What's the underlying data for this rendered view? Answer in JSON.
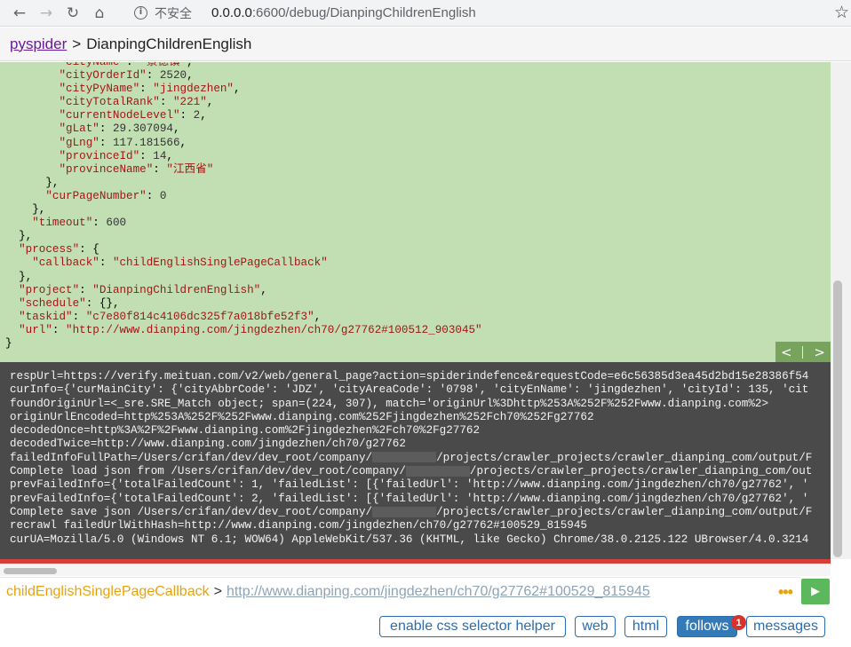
{
  "browser": {
    "back_icon": "back-arrow-icon",
    "forward_icon": "forward-arrow-icon",
    "insecure_label": "不安全",
    "url_host": "0.0.0.0",
    "url_rest": ":6600/debug/DianpingChildrenEnglish"
  },
  "header": {
    "brand": "pyspider",
    "separator": ">",
    "project": "DianpingChildrenEnglish"
  },
  "task_json": {
    "lines": [
      [
        "        ",
        "\"cityName\"",
        ": ",
        "\"景德镇\"",
        ","
      ],
      [
        "        ",
        "\"cityOrderId\"",
        ": ",
        "2520",
        ","
      ],
      [
        "        ",
        "\"cityPyName\"",
        ": ",
        "\"jingdezhen\"",
        ","
      ],
      [
        "        ",
        "\"cityTotalRank\"",
        ": ",
        "\"221\"",
        ","
      ],
      [
        "        ",
        "\"currentNodeLevel\"",
        ": ",
        "2",
        ","
      ],
      [
        "        ",
        "\"gLat\"",
        ": ",
        "29.307094",
        ","
      ],
      [
        "        ",
        "\"gLng\"",
        ": ",
        "117.181566",
        ","
      ],
      [
        "        ",
        "\"provinceId\"",
        ": ",
        "14",
        ","
      ],
      [
        "        ",
        "\"provinceName\"",
        ": ",
        "\"江西省\"",
        ""
      ],
      [
        "      ",
        "",
        "",
        "},",
        ""
      ],
      [
        "      ",
        "\"curPageNumber\"",
        ": ",
        "0",
        ""
      ],
      [
        "    ",
        "",
        "",
        "},",
        ""
      ],
      [
        "    ",
        "\"timeout\"",
        ": ",
        "600",
        ""
      ],
      [
        "  ",
        "",
        "",
        "},",
        ""
      ],
      [
        "  ",
        "\"process\"",
        ": ",
        "{",
        ""
      ],
      [
        "    ",
        "\"callback\"",
        ": ",
        "\"childEnglishSinglePageCallback\"",
        ""
      ],
      [
        "  ",
        "",
        "",
        "},",
        ""
      ],
      [
        "  ",
        "\"project\"",
        ": ",
        "\"DianpingChildrenEnglish\"",
        ","
      ],
      [
        "  ",
        "\"schedule\"",
        ": ",
        "{}",
        ","
      ],
      [
        "  ",
        "\"taskid\"",
        ": ",
        "\"c7e80f814c4106dc325f7a018bfe52f3\"",
        ","
      ],
      [
        "  ",
        "\"url\"",
        ": ",
        "\"http://www.dianping.com/jingdezhen/ch70/g27762#100512_903045\"",
        ""
      ],
      [
        "",
        "",
        "",
        "}",
        ""
      ]
    ],
    "pager_prev": "<",
    "pager_next": ">"
  },
  "log": {
    "lines": [
      "respUrl=https://verify.meituan.com/v2/web/general_page?action=spiderindefence&requestCode=e6c56385d3ea45d2bd15e28386f54",
      "curInfo={'curMainCity': {'cityAbbrCode': 'JDZ', 'cityAreaCode': '0798', 'cityEnName': 'jingdezhen', 'cityId': 135, 'cit",
      "foundOriginUrl=<_sre.SRE_Match object; span=(224, 307), match='originUrl%3Dhttp%253A%252F%252Fwww.dianping.com%2>",
      "originUrlEncoded=http%253A%252F%252Fwww.dianping.com%252Fjingdezhen%252Fch70%252Fg27762",
      "decodedOnce=http%3A%2F%2Fwww.dianping.com%2Fjingdezhen%2Fch70%2Fg27762",
      "decodedTwice=http://www.dianping.com/jingdezhen/ch70/g27762",
      "failedInfoFullPath=/Users/crifan/dev/dev_root/company/",
      "Complete load json from /Users/crifan/dev/dev_root/company/",
      "prevFailedInfo={'totalFailedCount': 1, 'failedList': [{'failedUrl': 'http://www.dianping.com/jingdezhen/ch70/g27762', '",
      "prevFailedInfo={'totalFailedCount': 2, 'failedList': [{'failedUrl': 'http://www.dianping.com/jingdezhen/ch70/g27762', '",
      "Complete save json /Users/crifan/dev/dev_root/company/",
      "recrawl failedUrlWithHash=http://www.dianping.com/jingdezhen/ch70/g27762#100529_815945",
      "curUA=Mozilla/5.0 (Windows NT 6.1; WOW64) AppleWebKit/537.36 (KHTML, like Gecko) Chrome/38.0.2125.122 UBrowser/4.0.3214"
    ],
    "blurred_suffixes": {
      "6": "/projects/crawler_projects/crawler_dianping_com/output/F",
      "7": "/projects/crawler_projects/crawler_dianping_com/out",
      "10": "/projects/crawler_projects/crawler_dianping_com/output/F"
    }
  },
  "crumb": {
    "callback": "childEnglishSinglePageCallback",
    "separator": ">",
    "url": "http://www.dianping.com/jingdezhen/ch70/g27762#100529_815945",
    "more": "•••",
    "run_icon": "play-icon"
  },
  "buttons": {
    "css_helper": "enable css selector helper",
    "web": "web",
    "html": "html",
    "follows": "follows",
    "follows_badge": "1",
    "messages": "messages"
  },
  "colors": {
    "task_bg": "#c2dfb4",
    "log_bg": "#4a4a4a",
    "accent": "#337ab7",
    "callback": "#e8a20f",
    "error_line": "#d43f3a"
  }
}
